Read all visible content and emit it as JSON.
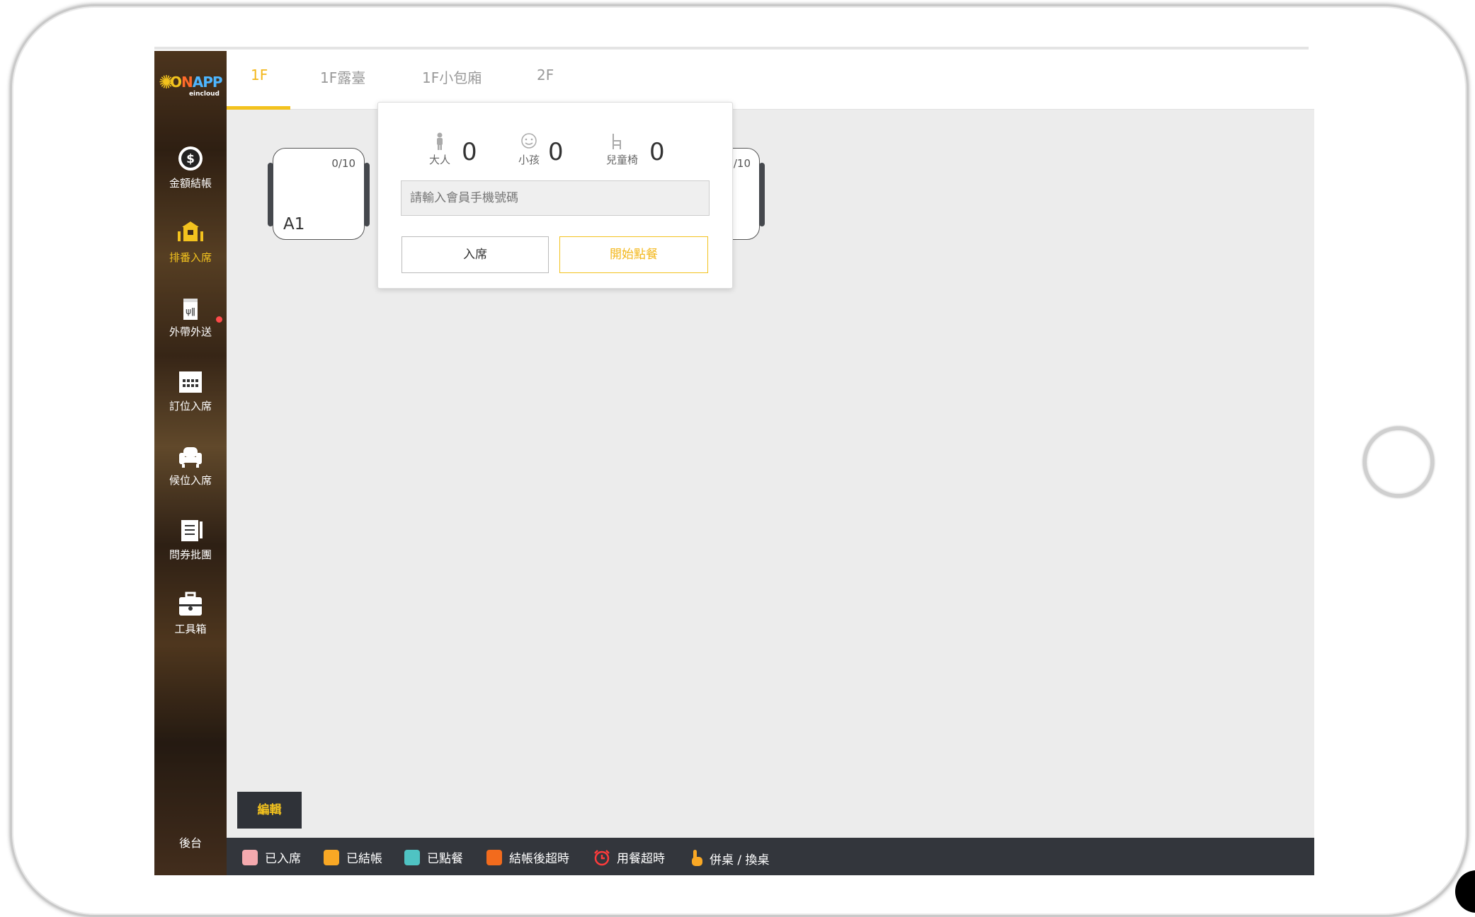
{
  "brand": {
    "logo_text_o": "O",
    "logo_text_n": "N",
    "logo_text_app": "APP",
    "logo_sub": "eincloud",
    "colors": {
      "accent": "#f3c21e",
      "sidebar_bg": "#4a3420"
    }
  },
  "sidebar": {
    "items": [
      {
        "label": "金額結帳",
        "icon": "coin-icon"
      },
      {
        "label": "排番入席",
        "icon": "store-queue-icon"
      },
      {
        "label": "外帶外送",
        "icon": "takeout-bag-icon"
      },
      {
        "label": "訂位入席",
        "icon": "calendar-icon"
      },
      {
        "label": "候位入席",
        "icon": "armchair-icon"
      },
      {
        "label": "問券批團",
        "icon": "clipboard-icon"
      },
      {
        "label": "工具箱",
        "icon": "toolbox-icon"
      }
    ],
    "backstage": "後台"
  },
  "tabs": [
    {
      "label": "1F",
      "active": true
    },
    {
      "label": "1F露臺",
      "active": false
    },
    {
      "label": "1F小包廂",
      "active": false
    },
    {
      "label": "2F",
      "active": false
    }
  ],
  "tables": [
    {
      "name": "A1",
      "capacity": "0/10"
    },
    {
      "name": "",
      "capacity": "0/10"
    }
  ],
  "popup": {
    "adult_label": "大人",
    "adult_value": "0",
    "child_label": "小孩",
    "child_value": "0",
    "highchair_label": "兒童椅",
    "highchair_value": "0",
    "phone_placeholder": "請輸入會員手機號碼",
    "seat_button": "入席",
    "order_button": "開始點餐"
  },
  "edit_button": "編輯",
  "legend": [
    {
      "label": "已入席",
      "color": "#f4a9ae"
    },
    {
      "label": "已結帳",
      "color": "#f9a825"
    },
    {
      "label": "已點餐",
      "color": "#4fc3c3"
    },
    {
      "label": "結帳後超時",
      "color": "#f26b1d"
    },
    {
      "label": "用餐超時",
      "icon": "alarm-clock-icon",
      "color": "#ff3b3b"
    },
    {
      "label": "併桌 / 換桌",
      "icon": "hand-pointer-icon",
      "color": "#f9a825"
    }
  ]
}
